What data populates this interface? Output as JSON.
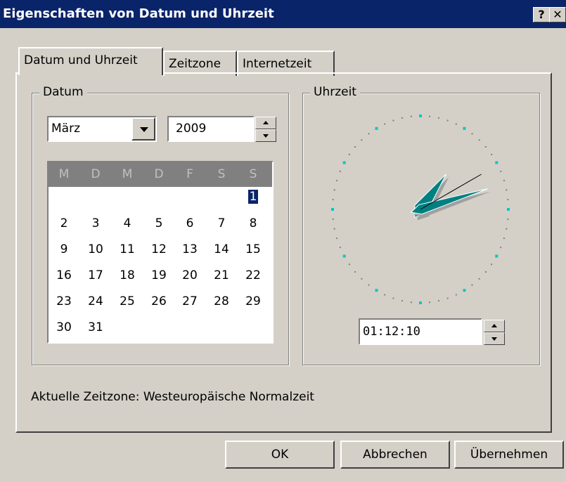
{
  "window": {
    "title": "Eigenschaften von Datum und Uhrzeit",
    "help_label": "?",
    "close_label": "✕"
  },
  "tabs": [
    {
      "label": "Datum und Uhrzeit",
      "active": true
    },
    {
      "label": "Zeitzone",
      "active": false
    },
    {
      "label": "Internetzeit",
      "active": false
    }
  ],
  "datum": {
    "group_label": "Datum",
    "month": "März",
    "year": "2009",
    "weekdays": [
      "M",
      "D",
      "M",
      "D",
      "F",
      "S",
      "S"
    ],
    "days": [
      [
        "",
        "",
        "",
        "",
        "",
        "",
        "1"
      ],
      [
        "2",
        "3",
        "4",
        "5",
        "6",
        "7",
        "8"
      ],
      [
        "9",
        "10",
        "11",
        "12",
        "13",
        "14",
        "15"
      ],
      [
        "16",
        "17",
        "18",
        "19",
        "20",
        "21",
        "22"
      ],
      [
        "23",
        "24",
        "25",
        "26",
        "27",
        "28",
        "29"
      ],
      [
        "30",
        "31",
        "",
        "",
        "",
        "",
        ""
      ]
    ],
    "selected_day": "1"
  },
  "uhrzeit": {
    "group_label": "Uhrzeit",
    "time": "01:12:10",
    "hand_color": "#008080"
  },
  "timezone_label": "Aktuelle Zeitzone: Westeuropäische Normalzeit",
  "buttons": {
    "ok": "OK",
    "cancel": "Abbrechen",
    "apply": "Übernehmen"
  },
  "colors": {
    "titlebar": "#0a246a",
    "face": "#d4d0c8",
    "calendar_header": "#808080",
    "tick_highlight": "#00c8c8"
  }
}
